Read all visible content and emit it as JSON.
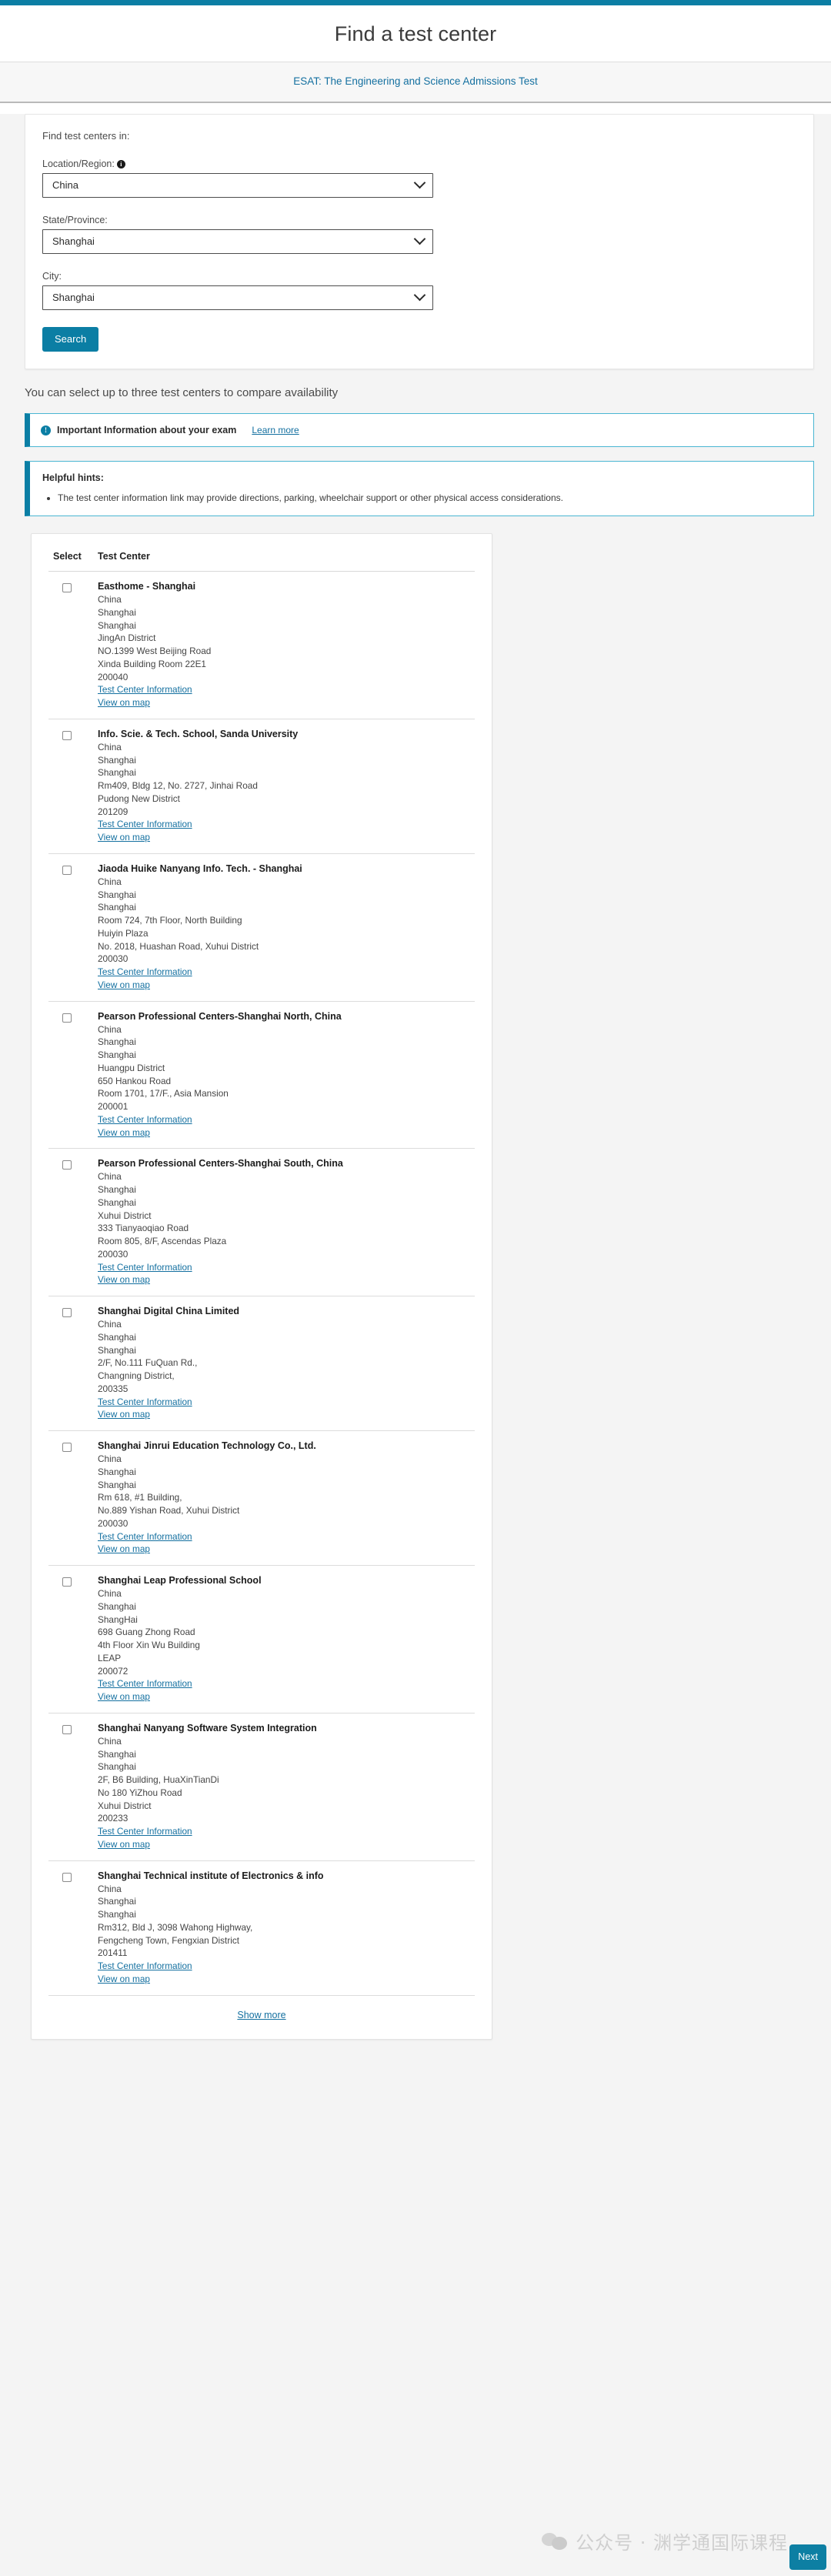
{
  "header": {
    "title": "Find a test center",
    "exam_link": "ESAT: The Engineering and Science Admissions Test"
  },
  "search_form": {
    "intro": "Find test centers in:",
    "location_label": "Location/Region:",
    "info_icon_glyph": "i",
    "location_value": "China",
    "state_label": "State/Province:",
    "state_value": "Shanghai",
    "city_label": "City:",
    "city_value": "Shanghai",
    "search_button": "Search"
  },
  "compare_note": "You can select up to three test centers to compare availability",
  "alerts": {
    "important": {
      "icon_glyph": "!",
      "text": "Important Information about your exam",
      "link": "Learn more"
    },
    "hints": {
      "title": "Helpful hints:",
      "items": [
        "The test center information link may provide directions, parking, wheelchair support or other physical access considerations."
      ]
    }
  },
  "results": {
    "columns": {
      "select": "Select",
      "test_center": "Test Center"
    },
    "info_link_label": "Test Center Information",
    "map_link_label": "View on map",
    "show_more": "Show more",
    "centers": [
      {
        "name": "Easthome - Shanghai",
        "address": [
          "China",
          "Shanghai",
          "Shanghai",
          "JingAn District",
          "NO.1399 West Beijing Road",
          "Xinda Building Room 22E1",
          "200040"
        ]
      },
      {
        "name": "Info. Scie. & Tech. School, Sanda University",
        "address": [
          "China",
          "Shanghai",
          "Shanghai",
          "Rm409, Bldg 12, No. 2727, Jinhai Road",
          "Pudong New District",
          "201209"
        ]
      },
      {
        "name": "Jiaoda Huike Nanyang Info. Tech. - Shanghai",
        "address": [
          "China",
          "Shanghai",
          "Shanghai",
          "Room 724, 7th Floor, North Building",
          "Huiyin Plaza",
          "No. 2018, Huashan Road, Xuhui District",
          "200030"
        ]
      },
      {
        "name": "Pearson Professional Centers-Shanghai North, China",
        "address": [
          "China",
          "Shanghai",
          "Shanghai",
          "Huangpu District",
          "650 Hankou Road",
          "Room 1701, 17/F., Asia Mansion",
          "200001"
        ]
      },
      {
        "name": "Pearson Professional Centers-Shanghai South, China",
        "address": [
          "China",
          "Shanghai",
          "Shanghai",
          "Xuhui District",
          "333 Tianyaoqiao Road",
          "Room 805, 8/F, Ascendas Plaza",
          "200030"
        ]
      },
      {
        "name": "Shanghai Digital China Limited",
        "address": [
          "China",
          "Shanghai",
          "Shanghai",
          "2/F, No.111 FuQuan Rd.,",
          "Changning District,",
          "200335"
        ]
      },
      {
        "name": "Shanghai Jinrui Education Technology Co., Ltd.",
        "address": [
          "China",
          "Shanghai",
          "Shanghai",
          "Rm 618, #1 Building,",
          "No.889 Yishan Road, Xuhui District",
          "200030"
        ]
      },
      {
        "name": "Shanghai Leap Professional School",
        "address": [
          "China",
          "Shanghai",
          "ShangHai",
          "698 Guang Zhong Road",
          "4th Floor Xin Wu Building",
          "LEAP",
          "200072"
        ]
      },
      {
        "name": "Shanghai Nanyang Software System Integration",
        "address": [
          "China",
          "Shanghai",
          "Shanghai",
          "2F, B6 Building, HuaXinTianDi",
          "No 180 YiZhou Road",
          "Xuhui District",
          "200233"
        ]
      },
      {
        "name": "Shanghai Technical institute of Electronics & info",
        "address": [
          "China",
          "Shanghai",
          "Shanghai",
          "Rm312, Bld J, 3098 Wahong Highway,",
          "Fengcheng Town, Fengxian District",
          "201411"
        ]
      }
    ]
  },
  "watermark": {
    "text": "公众号 · 渊学通国际课程"
  },
  "next_button": {
    "label": "Next"
  },
  "colors": {
    "accent": "#0b7ea4",
    "link": "#1470a0",
    "page_bg": "#f4f4f4",
    "card_bg": "#ffffff"
  }
}
